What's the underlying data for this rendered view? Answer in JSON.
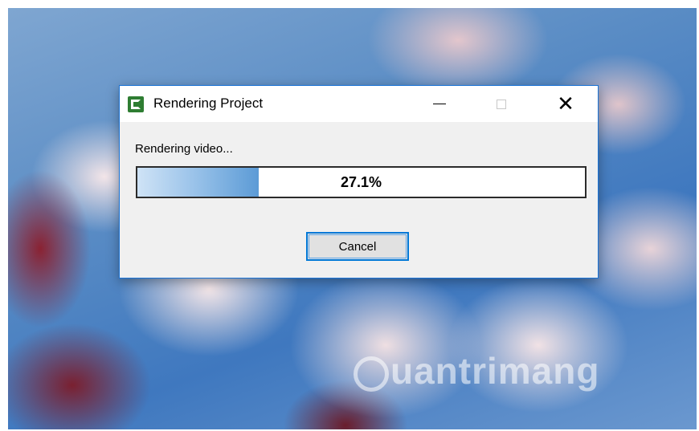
{
  "dialog": {
    "title": "Rendering Project",
    "app_icon": "camtasia-app-icon",
    "status": "Rendering video...",
    "progress_value": 27.1,
    "progress_label": "27.1%",
    "cancel_label": "Cancel",
    "window_controls": {
      "minimize": "minimize-icon",
      "maximize": "maximize-icon",
      "close": "close-icon"
    }
  },
  "watermark": {
    "text": "uantrimang"
  },
  "colors": {
    "dialog_border": "#1a73d6",
    "cancel_border": "#0078d7",
    "progress_fill": "#5c9bd6"
  }
}
